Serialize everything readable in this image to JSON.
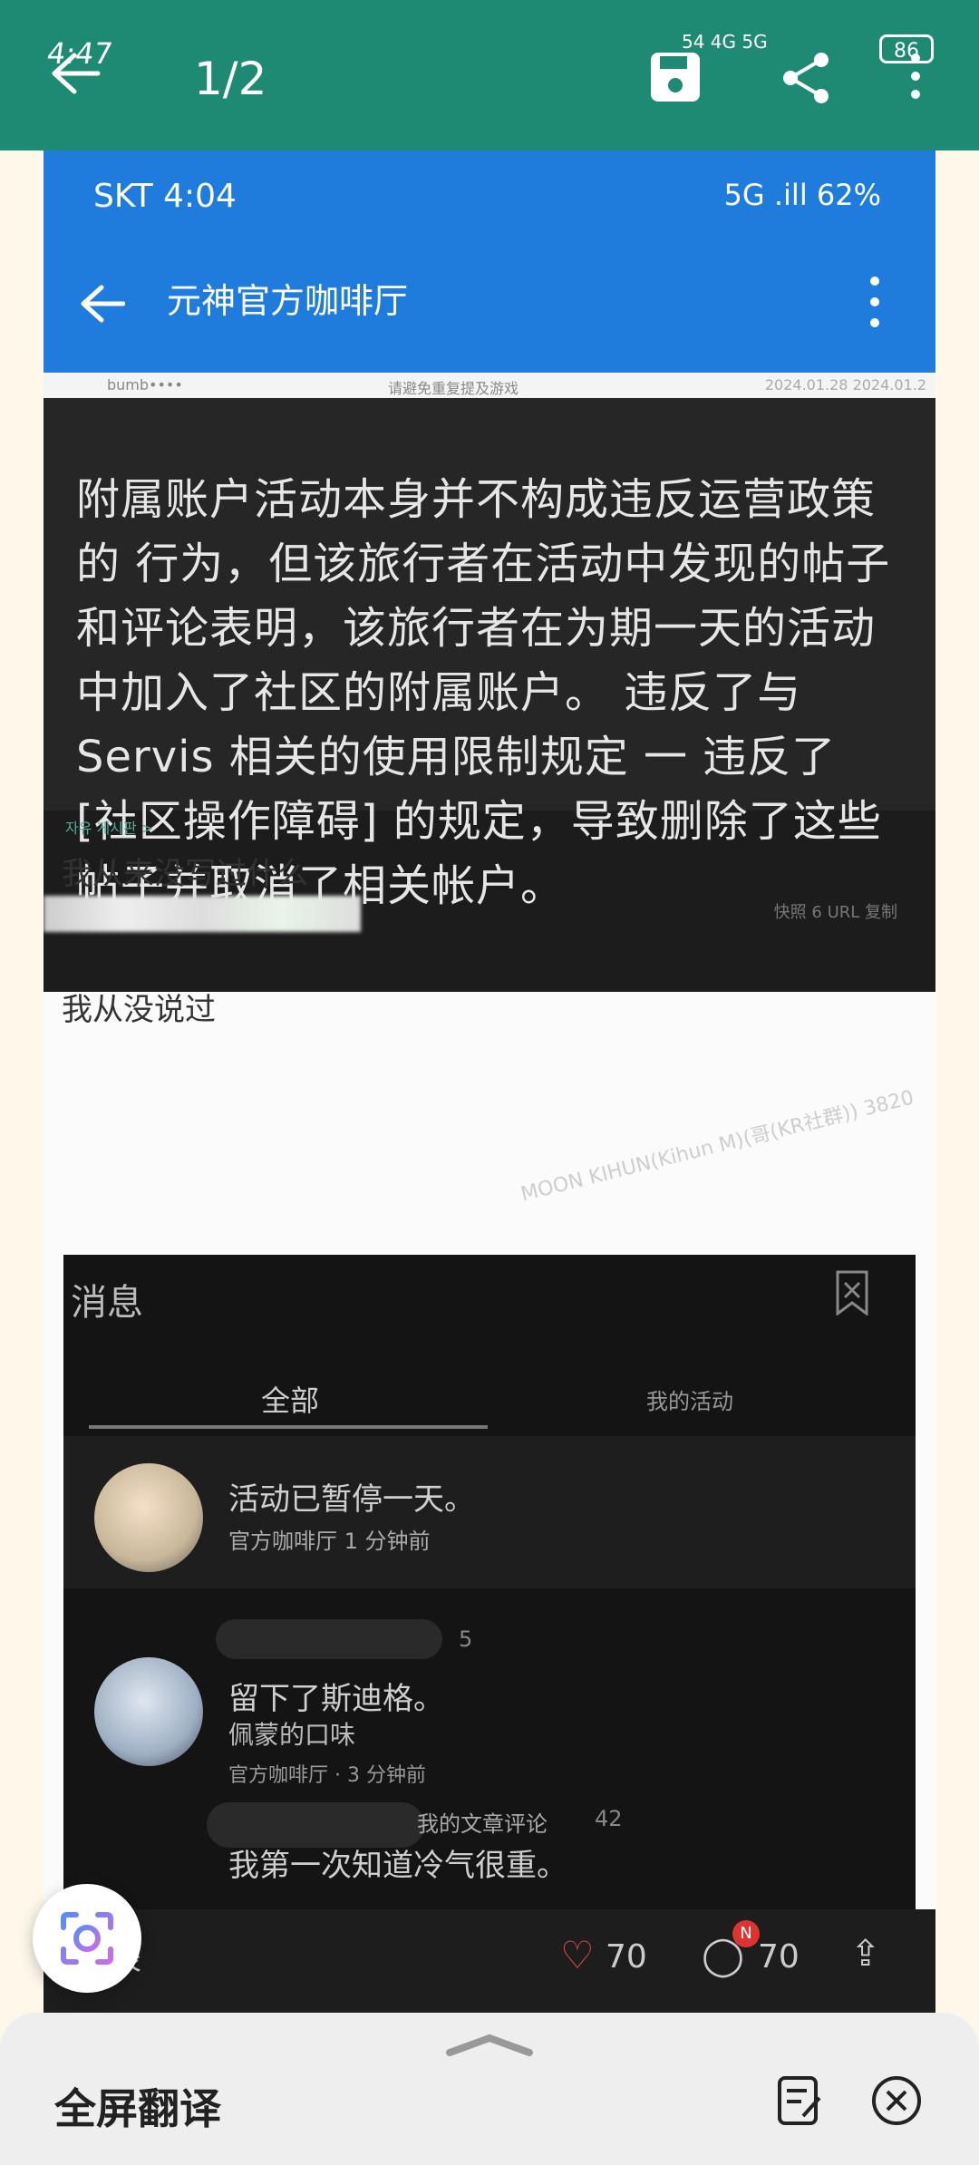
{
  "viewer": {
    "time": "4:47",
    "pager": "1/2",
    "status_text": "54 4G 5G",
    "battery": "86"
  },
  "inner_status": {
    "left": "SKT 4:04",
    "right": "5G .ill 62%"
  },
  "inner_bar": {
    "title": "元神官方咖啡厅"
  },
  "strip": {
    "user": "bumb••••",
    "search": "请避免重复提及游戏",
    "dates": "2024.01.28 2024.01.2"
  },
  "notice_text": "附属账户活动本身并不构成违反运营政策的 行为，但该旅行者在活动中发现的帖子和评论表明，该旅行者在为期一天的活动中加入了社区的附属账户。 违反了与 Servis 相关的使用限制规定 一 违反了 [社区操作障碍] 的规定，导致删除了这些帖子并取消了相关帐户。",
  "board_label": "자유 게시판 >",
  "line1": "我从来没写过什么",
  "meta": "快照 6 URL 复制",
  "line2": "我从没说过",
  "watermark": "MOON KIHUN(Kihun M)(哥(KR社群)) 3820",
  "panel": {
    "title": "消息",
    "tabs": [
      "全部",
      "我的活动"
    ],
    "items": [
      {
        "title": "活动已暂停一天。",
        "sub": "官方咖啡厅 1 分钟前"
      },
      {
        "count": "5",
        "title": "留下了斯迪格。",
        "sub": "佩蒙的口味",
        "time": "官方咖啡厅 · 3 分钟前"
      },
      {
        "label": "我的文章评论",
        "count": "42",
        "title": "我第一次知道冷气很重。"
      }
    ]
  },
  "inner_bottom": {
    "list": "列表",
    "likes": "70",
    "comments": "70",
    "badge": "N"
  },
  "sheet": {
    "title": "全屏翻译"
  }
}
